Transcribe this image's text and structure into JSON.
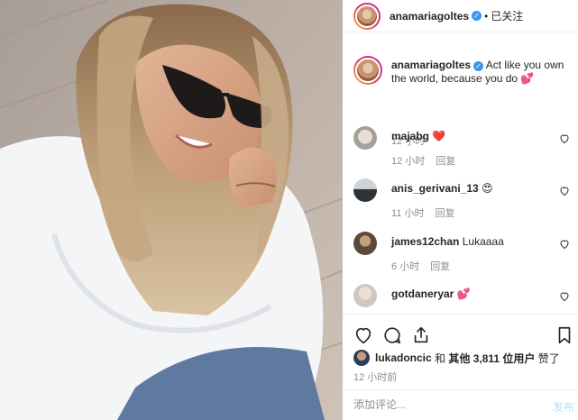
{
  "header": {
    "username": "anamariagoltes",
    "verified_mark": "✓",
    "separator": "•",
    "follow_label": "已关注"
  },
  "caption": {
    "username": "anamariagoltes",
    "text": "Act like you own the world, because you do 💕",
    "time": "12 小时"
  },
  "comments": [
    {
      "username": "majabg",
      "text": "❤️",
      "time": "12 小时",
      "reply": "回复"
    },
    {
      "username": "anis_gerivani_13",
      "text": "😍",
      "time": "11 小时",
      "reply": "回复"
    },
    {
      "username": "james12chan",
      "text": "Lukaaaa",
      "time": "6 小时",
      "reply": "回复"
    },
    {
      "username": "gotdaneryar",
      "text": "💕",
      "time": "",
      "reply": ""
    }
  ],
  "likes": {
    "liker": "lukadoncic",
    "and": "和",
    "others": "其他 3,811 位用户",
    "liked": "赞了"
  },
  "post_time": "12 小时前",
  "add_comment": {
    "placeholder": "添加评论...",
    "post_label": "发布"
  },
  "icons": [
    "verified-badge-icon",
    "heart-icon",
    "comment-icon",
    "share-icon",
    "bookmark-icon"
  ],
  "colors": {
    "verified": "#3897f0",
    "meta": "#8e8e8e",
    "post_btn": "#b2dffc"
  }
}
